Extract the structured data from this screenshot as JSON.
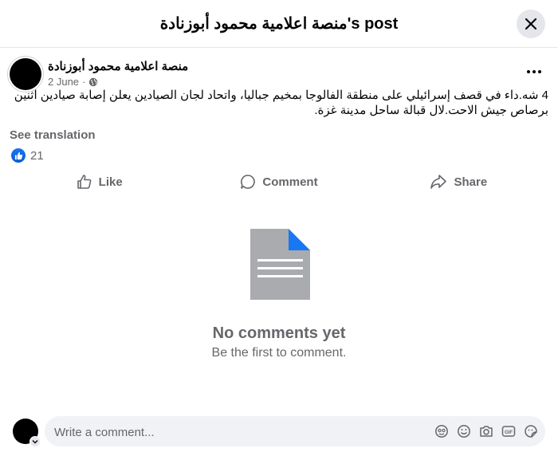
{
  "header": {
    "title": "منصة اعلامية محمود أبوزنادة's post",
    "close_icon": "close-icon"
  },
  "post": {
    "author": "منصة اعلامية محمود أبوزنادة",
    "date": "2 June",
    "separator": "·",
    "privacy_icon": "globe-icon",
    "text": "4 شه.داء في قصف إسرائيلي على منطقة الفالوجا بمخيم جباليا، واتحاد لجان الصيادين يعلن إصابة صيادين اثنين برصاص جيش الاحت.لال قبالة ساحل مدينة غزة.",
    "see_translation": "See translation",
    "reaction_count": "21"
  },
  "actions": {
    "like": "Like",
    "comment": "Comment",
    "share": "Share"
  },
  "empty_state": {
    "title": "No comments yet",
    "subtitle": "Be the first to comment."
  },
  "composer": {
    "placeholder": "Write a comment...",
    "icons": [
      "avatar-sticker-icon",
      "emoji-icon",
      "camera-icon",
      "gif-icon",
      "sticker-icon"
    ]
  },
  "colors": {
    "accent": "#1877f2",
    "secondary_text": "#65676b",
    "surface": "#f0f2f5",
    "doc_gray": "#a9abae"
  }
}
